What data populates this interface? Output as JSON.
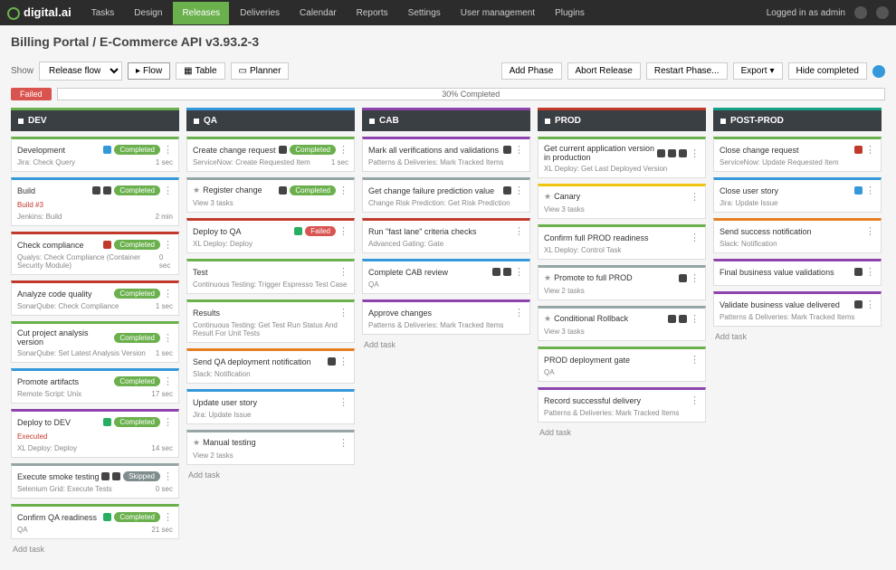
{
  "header": {
    "logo": "digital.ai",
    "nav": [
      "Tasks",
      "Design",
      "Releases",
      "Deliveries",
      "Calendar",
      "Reports",
      "Settings",
      "User management",
      "Plugins"
    ],
    "active_nav": 2,
    "logged_in": "Logged in as admin"
  },
  "breadcrumb": "Billing Portal  /  E-Commerce API v3.93.2-3",
  "toolbar": {
    "show_label": "Show",
    "show_value": "Release flow",
    "view_flow": "Flow",
    "view_table": "Table",
    "view_planner": "Planner",
    "add_phase": "Add Phase",
    "abort": "Abort Release",
    "restart": "Restart Phase...",
    "export": "Export",
    "hide_completed": "Hide completed"
  },
  "progress": {
    "failed_label": "Failed",
    "text": "30% Completed"
  },
  "columns": [
    {
      "name": "DEV",
      "color": "c-green"
    },
    {
      "name": "QA",
      "color": "c-blue"
    },
    {
      "name": "CAB",
      "color": "c-purple"
    },
    {
      "name": "PROD",
      "color": "c-red"
    },
    {
      "name": "POST-PROD",
      "color": "c-teal"
    }
  ],
  "dev_cards": [
    {
      "title": "Development",
      "sub": "Jira: Check Query",
      "badge": "Completed",
      "icons": [
        "blue"
      ],
      "right": "1 sec",
      "border": "b-green"
    },
    {
      "title": "Build",
      "sub": "Jenkins: Build",
      "extra": "Build #3",
      "badge": "Completed",
      "icons": [
        "dark",
        "dark"
      ],
      "right": "2 min",
      "border": "b-blue"
    },
    {
      "title": "Check compliance",
      "sub": "Qualys: Check Compliance (Container Security Module)",
      "badge": "Completed",
      "icons": [
        "red"
      ],
      "right": "0 sec",
      "border": "b-red"
    },
    {
      "title": "Analyze code quality",
      "sub": "SonarQube: Check Compliance",
      "badge": "Completed",
      "right": "1 sec",
      "border": "b-red"
    },
    {
      "title": "Cut project analysis version",
      "sub": "SonarQube: Set Latest Analysis Version",
      "badge": "Completed",
      "right": "1 sec",
      "border": "b-green"
    },
    {
      "title": "Promote artifacts",
      "sub": "Remote Script: Unix",
      "badge": "Completed",
      "right": "17 sec",
      "border": "b-blue"
    },
    {
      "title": "Deploy to DEV",
      "sub": "XL Deploy: Deploy",
      "extra": "Executed",
      "badge": "Completed",
      "icons": [
        "green"
      ],
      "right": "14 sec",
      "border": "b-purple"
    },
    {
      "title": "Execute smoke testing",
      "sub": "Selenium Grid: Execute Tests",
      "badge": "Skipped",
      "icons": [
        "dark",
        "dark"
      ],
      "right": "0 sec",
      "border": "b-gray"
    },
    {
      "title": "Confirm QA readiness",
      "sub": "QA",
      "badge": "Completed",
      "icons": [
        "green"
      ],
      "right": "21 sec",
      "border": "b-green"
    }
  ],
  "qa_cards": [
    {
      "title": "Create change request",
      "sub": "ServiceNow: Create Requested Item",
      "badge": "Completed",
      "icons": [
        "dark"
      ],
      "right": "1 sec",
      "border": "b-green"
    },
    {
      "title": "Register change",
      "sub": "View 3 tasks",
      "badge": "Completed",
      "star": true,
      "border": "b-gray",
      "icons": [
        "dark"
      ]
    },
    {
      "title": "Deploy to QA",
      "sub": "XL Deploy: Deploy",
      "badge": "Failed",
      "icons": [
        "green"
      ],
      "border": "b-red",
      "failed": true
    },
    {
      "title": "Test",
      "sub": "Continuous Testing: Trigger Espresso Test Case",
      "border": "b-green"
    },
    {
      "title": "Results",
      "sub": "Continuous Testing: Get Test Run Status And Result For Unit Tests",
      "border": "b-green"
    },
    {
      "title": "Send QA deployment notification",
      "sub": "Slack: Notification",
      "icons": [
        "dark"
      ],
      "border": "b-orange"
    },
    {
      "title": "Update user story",
      "sub": "Jira: Update Issue",
      "border": "b-blue"
    },
    {
      "title": "Manual testing",
      "sub": "View 2 tasks",
      "star": true,
      "border": "b-gray"
    }
  ],
  "cab_cards": [
    {
      "title": "Mark all verifications and validations",
      "sub": "Patterns & Deliveries: Mark Tracked Items",
      "icons": [
        "dark"
      ],
      "border": "b-purple"
    },
    {
      "title": "Get change failure prediction value",
      "sub": "Change Risk Prediction: Get Risk Prediction",
      "icons": [
        "dark"
      ],
      "border": "b-gray"
    },
    {
      "title": "Run \"fast lane\" criteria checks",
      "sub": "Advanced Gating: Gate",
      "border": "b-red"
    },
    {
      "title": "Complete CAB review",
      "sub": "QA",
      "icons": [
        "dark",
        "dark"
      ],
      "border": "b-blue"
    },
    {
      "title": "Approve changes",
      "sub": "Patterns & Deliveries: Mark Tracked Items",
      "border": "b-purple"
    }
  ],
  "prod_cards": [
    {
      "title": "Get current application version in production",
      "sub": "XL Deploy: Get Last Deployed Version",
      "icons": [
        "dark",
        "dark",
        "dark"
      ],
      "border": "b-green"
    },
    {
      "title": "Canary",
      "sub": "View 3 tasks",
      "star": true,
      "border": "b-yellow"
    },
    {
      "title": "Confirm full PROD readiness",
      "sub": "XL Deploy: Control Task",
      "border": "b-green"
    },
    {
      "title": "Promote to full PROD",
      "sub": "View 2 tasks",
      "star": true,
      "icons": [
        "dark"
      ],
      "border": "b-gray"
    },
    {
      "title": "Conditional Rollback",
      "sub": "View 3 tasks",
      "star": true,
      "icons": [
        "dark",
        "dark"
      ],
      "border": "b-gray"
    },
    {
      "title": "PROD deployment gate",
      "sub": "QA",
      "border": "b-green"
    },
    {
      "title": "Record successful delivery",
      "sub": "Patterns & Deliveries: Mark Tracked Items",
      "border": "b-purple"
    }
  ],
  "post_cards": [
    {
      "title": "Close change request",
      "sub": "ServiceNow: Update Requested Item",
      "icons": [
        "red"
      ],
      "border": "b-green"
    },
    {
      "title": "Close user story",
      "sub": "Jira: Update Issue",
      "icons": [
        "blue"
      ],
      "border": "b-blue"
    },
    {
      "title": "Send success notification",
      "sub": "Slack: Notification",
      "border": "b-orange"
    },
    {
      "title": "Final business value validations",
      "sub": "",
      "icons": [
        "dark"
      ],
      "border": "b-purple"
    },
    {
      "title": "Validate business value delivered",
      "sub": "Patterns & Deliveries: Mark Tracked Items",
      "icons": [
        "dark"
      ],
      "border": "b-purple"
    }
  ],
  "add_task": "Add task"
}
